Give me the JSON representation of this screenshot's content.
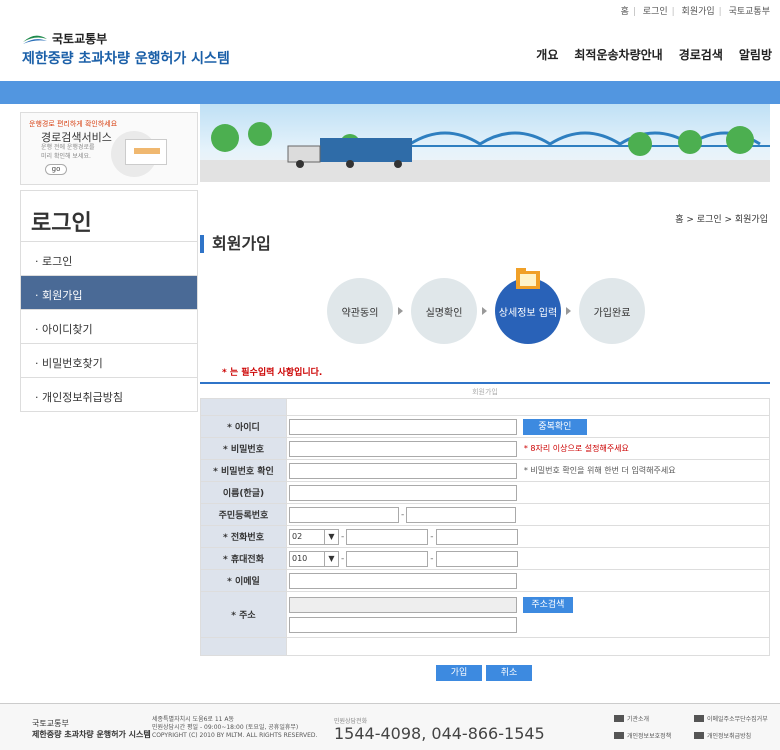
{
  "top_links": [
    "홈",
    "로그인",
    "회원가입",
    "국토교통부"
  ],
  "ministry": "국토교통부",
  "system_name": "제한중량 초과차량 운행허가 시스템",
  "gnb": [
    "개요",
    "최적운송차량안내",
    "경로검색",
    "알림방"
  ],
  "promo": {
    "line1": "운행경로 편리하게 확인하세요",
    "line2": "경로검색서비스",
    "line3a": "운행 전에 운행경로를",
    "line3b": "미리 확인해 보세요.",
    "go": "go"
  },
  "sidebar": {
    "title": "로그인",
    "items": [
      "· 로그인",
      "· 회원가입",
      "· 아이디찾기",
      "· 비밀번호찾기",
      "· 개인정보취급방침"
    ]
  },
  "breadcrumb": "홈 > 로그인 > 회원가입",
  "page_title": "회원가입",
  "steps": [
    "약관동의",
    "실명확인",
    "상세정보 입력",
    "가입완료"
  ],
  "required_note": "* 는 필수입력 사항입니다.",
  "table_caption": "회원가입",
  "form": {
    "id_label": "* 아이디",
    "dup_check": "중복확인",
    "pw_label": "* 비밀번호",
    "pw_hint": "* 8자리 이상으로 설정해주세요",
    "pw2_label": "* 비밀번호 확인",
    "pw2_hint": "* 비밀번호 확인을 위해 한번 더 입력해주세요",
    "name_label": "이름(한글)",
    "rrn_label": "주민등록번호",
    "tel_label": "* 전화번호",
    "tel_area": "02",
    "mobile_label": "* 휴대전화",
    "mobile_prefix": "010",
    "email_label": "* 이메일",
    "addr_label": "* 주소",
    "addr_search": "주소검색"
  },
  "actions": {
    "join": "가입",
    "cancel": "취소"
  },
  "footer": {
    "ministry": "국토교통부",
    "system": "제한중량 초과차량 운행허가 시스템",
    "addr1": "세종특별자치시 도움6로 11 A동",
    "addr2": "민원상담시간 평일 - 09:00~18:00 (토요일, 공휴일휴무)",
    "copyright": "COPYRIGHT (C) 2010 BY MLTM. ALL RIGHTS RESERVED.",
    "phone_label": "민원상담전화",
    "phone": "1544-4098, 044-866-1545",
    "links": [
      "기관소개",
      "이메일주소무단수집거부",
      "개인정보보호정책",
      "개인정보취급방침"
    ]
  }
}
